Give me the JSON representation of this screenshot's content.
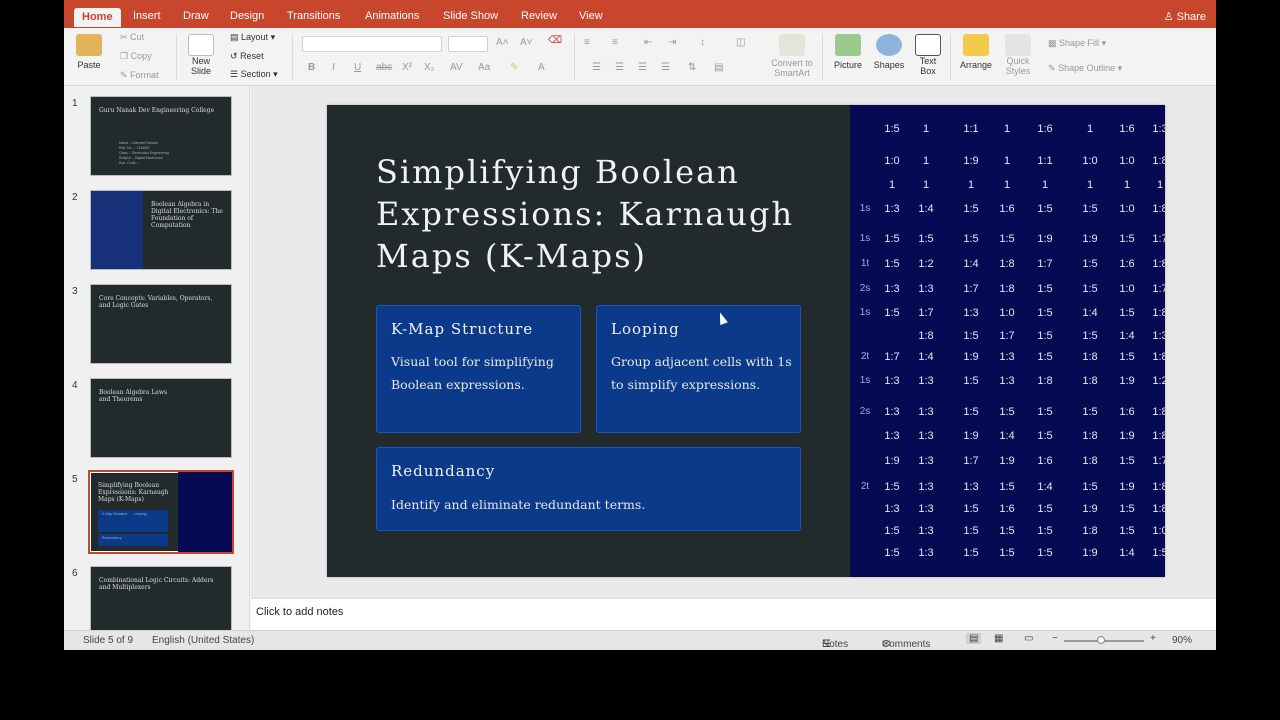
{
  "ribbon_tabs": [
    "Home",
    "Insert",
    "Draw",
    "Design",
    "Transitions",
    "Animations",
    "Slide Show",
    "Review",
    "View"
  ],
  "share_label": "Share",
  "ribbon": {
    "paste": "Paste",
    "cut": "Cut",
    "copy": "Copy",
    "format": "Format",
    "new_slide_1": "New",
    "new_slide_2": "Slide",
    "layout": "Layout",
    "reset": "Reset",
    "section": "Section",
    "convert_1": "Convert to",
    "convert_2": "SmartArt",
    "picture": "Picture",
    "shapes": "Shapes",
    "textbox_1": "Text",
    "textbox_2": "Box",
    "arrange": "Arrange",
    "quick_1": "Quick",
    "quick_2": "Styles",
    "shape_fill": "Shape Fill",
    "shape_outline": "Shape Outline"
  },
  "thumbnails": [
    {
      "num": "1",
      "title": "Guru Nanak Dev Engineering College",
      "lines": [
        "Name :- Navneet Sahota",
        "Roll. No. :- 1234567",
        "Class :- Electronics Engineering",
        "Subject :- Digital Electronics",
        "Sub. Code :-"
      ]
    },
    {
      "num": "2",
      "title": "Boolean Algebra in Digital Electronics: The Foundation of Computation",
      "lines": []
    },
    {
      "num": "3",
      "title": "Core Concepts: Variables, Operators, and Logic Gates",
      "lines": []
    },
    {
      "num": "4",
      "title": "Boolean Algebra Laws and Theorems",
      "lines": []
    },
    {
      "num": "5",
      "title": "Simplifying Boolean Expressions: Karnaugh Maps (K-Maps)",
      "lines": [
        "K-Map Structure",
        "Looping",
        "Redundancy"
      ]
    },
    {
      "num": "6",
      "title": "Combinational Logic Circuits: Adders and Multiplexers",
      "lines": []
    }
  ],
  "slide": {
    "title": "Simplifying Boolean Expressions: Karnaugh Maps (K-Maps)",
    "cards": [
      {
        "title": "K-Map Structure",
        "body": "Visual tool for simplifying Boolean expressions."
      },
      {
        "title": "Looping",
        "body": "Group adjacent cells with 1s to simplify expressions."
      },
      {
        "title": "Redundancy",
        "body": "Identify and eliminate redundant terms."
      }
    ],
    "grid": {
      "row_labels": [
        "",
        "",
        "",
        "1s",
        "1s",
        "1t",
        "2s",
        "1s",
        "",
        "2t",
        "1s",
        "2s",
        "",
        "",
        "2t",
        "",
        "",
        ""
      ],
      "rows": [
        [
          "1:5",
          "1",
          "1:1",
          "1",
          "1:6",
          "1",
          "1:6",
          "1:3"
        ],
        [
          "1:0",
          "1",
          "1:9",
          "1",
          "1:1",
          "1:0",
          "1:0",
          "1:8"
        ],
        [
          "1",
          "1",
          "1",
          "1",
          "1",
          "1",
          "1",
          "1"
        ],
        [
          "1:3",
          "1:4",
          "1:5",
          "1:6",
          "1:5",
          "1:5",
          "1:0",
          "1:8"
        ],
        [
          "1:5",
          "1:5",
          "1:5",
          "1:5",
          "1:9",
          "1:9",
          "1:5",
          "1:7"
        ],
        [
          "1:5",
          "1:2",
          "1:4",
          "1:8",
          "1:7",
          "1:5",
          "1:6",
          "1:8"
        ],
        [
          "1:3",
          "1:3",
          "1:7",
          "1:8",
          "1:5",
          "1:5",
          "1:0",
          "1:7"
        ],
        [
          "1:5",
          "1:7",
          "1:3",
          "1:0",
          "1:5",
          "1:4",
          "1:5",
          "1:8"
        ],
        [
          "",
          "1:8",
          "1:5",
          "1:7",
          "1:5",
          "1:5",
          "1:4",
          "1:3"
        ],
        [
          "1:7",
          "1:4",
          "1:9",
          "1:3",
          "1:5",
          "1:8",
          "1:5",
          "1:8"
        ],
        [
          "1:3",
          "1:3",
          "1:5",
          "1:3",
          "1:8",
          "1:8",
          "1:9",
          "1:2"
        ],
        [
          "1:3",
          "1:3",
          "1:5",
          "1:5",
          "1:5",
          "1:5",
          "1:6",
          "1:8"
        ],
        [
          "1:3",
          "1:3",
          "1:9",
          "1:4",
          "1:5",
          "1:8",
          "1:9",
          "1:8"
        ],
        [
          "1:9",
          "1:3",
          "1:7",
          "1:9",
          "1:6",
          "1:8",
          "1:5",
          "1:7"
        ],
        [
          "1:5",
          "1:3",
          "1:3",
          "1:5",
          "1:4",
          "1:5",
          "1:9",
          "1:8"
        ],
        [
          "1:3",
          "1:3",
          "1:5",
          "1:6",
          "1:5",
          "1:9",
          "1:5",
          "1:8"
        ],
        [
          "1:5",
          "1:3",
          "1:5",
          "1:5",
          "1:5",
          "1:8",
          "1:5",
          "1:0"
        ],
        [
          "1:5",
          "1:3",
          "1:5",
          "1:5",
          "1:5",
          "1:9",
          "1:4",
          "1:5"
        ]
      ]
    }
  },
  "notes_placeholder": "Click to add notes",
  "status": {
    "slide_of": "Slide 5 of 9",
    "language": "English (United States)",
    "notes": "Notes",
    "comments": "Comments",
    "zoom": "90%"
  },
  "colors": {
    "accent": "#c8462c",
    "slide_bg": "#222a2b",
    "card": "#0b3a8a",
    "grid_bg": "#050a52"
  }
}
